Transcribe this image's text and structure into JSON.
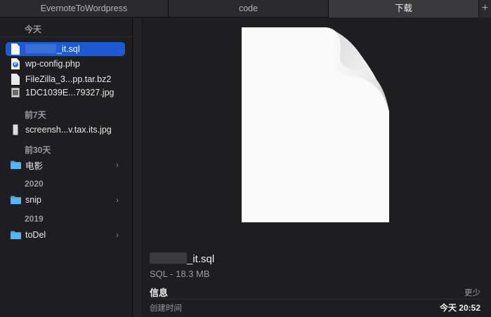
{
  "tabs": [
    {
      "label": "EvernoteToWordpress"
    },
    {
      "label": "code"
    },
    {
      "label": "下载"
    }
  ],
  "tab_add_label": "+",
  "sections": [
    {
      "header": "今天",
      "items": [
        {
          "label": "_it.sql",
          "icon": "document-icon",
          "selected": true,
          "redacted_prefix": true
        },
        {
          "label": "wp-config.php",
          "icon": "php-file-icon"
        },
        {
          "label": "FileZilla_3...pp.tar.bz2",
          "icon": "document-icon"
        },
        {
          "label": "1DC1039E...79327.jpg",
          "icon": "image-file-icon"
        }
      ]
    },
    {
      "header": "前7天",
      "items": [
        {
          "label": "screensh...v.tax.its.jpg",
          "icon": "phone-screenshot-icon"
        }
      ]
    },
    {
      "header": "前30天",
      "items": [
        {
          "label": "电影",
          "icon": "folder-icon",
          "chevron": "›"
        }
      ]
    },
    {
      "header": "2020",
      "items": [
        {
          "label": "snip",
          "icon": "folder-icon",
          "chevron": "›"
        }
      ]
    },
    {
      "header": "2019",
      "items": [
        {
          "label": "toDel",
          "icon": "folder-icon",
          "chevron": "›"
        }
      ]
    }
  ],
  "preview": {
    "file_name_suffix": "_it.sql",
    "file_meta": "SQL - 18.3 MB",
    "info_title": "信息",
    "more_label": "更少",
    "created_label": "创建时间",
    "created_value": "今天 20:52"
  },
  "colors": {
    "selection": "#1c5ad6",
    "folder": "#3fa8f0",
    "background": "#1e1e20"
  }
}
